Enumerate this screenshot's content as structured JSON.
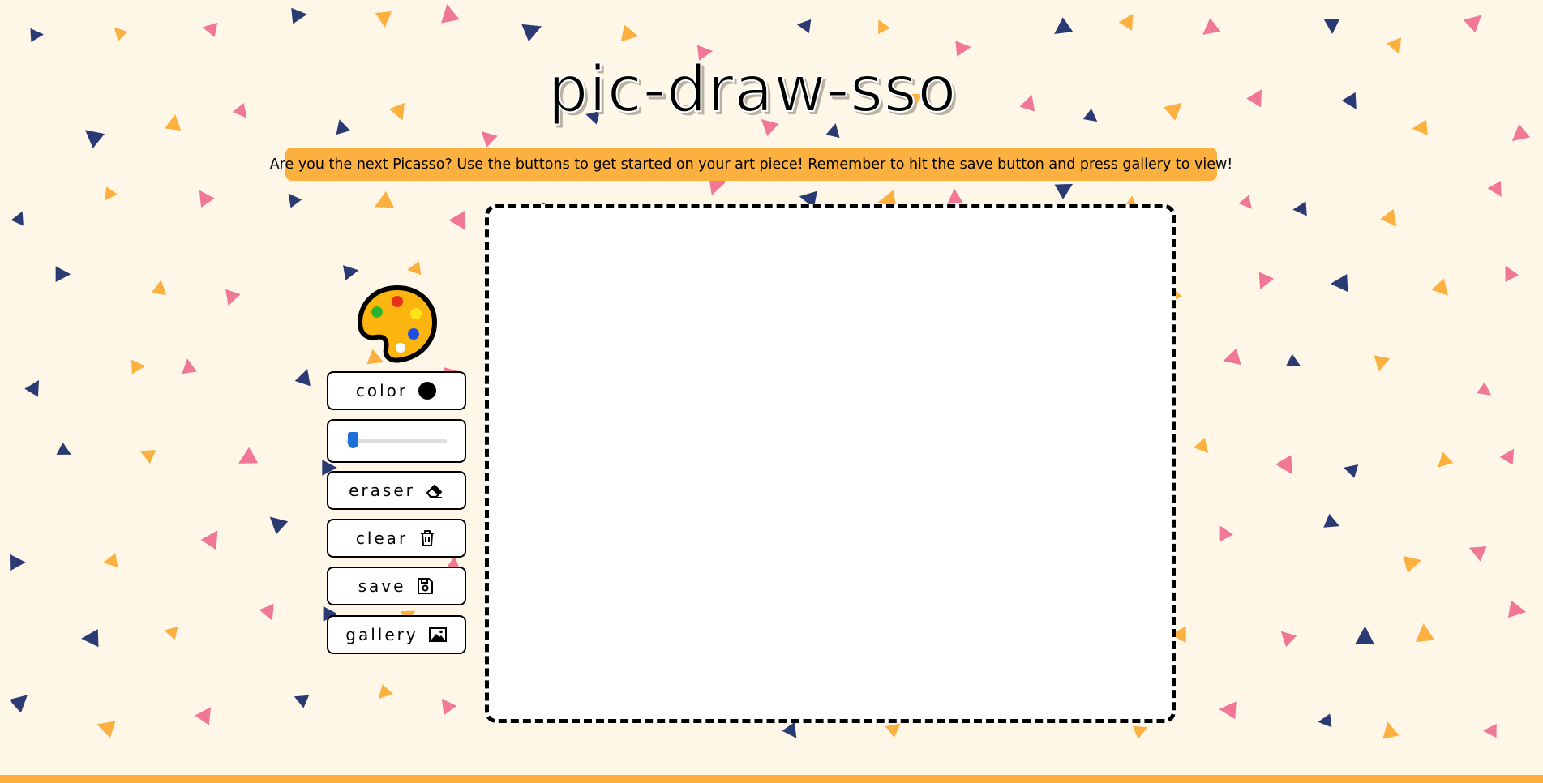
{
  "app": {
    "title": "pic-draw-sso",
    "instructions": "Are you the next Picasso? Use the buttons to get started on your art piece! Remember to hit the save button and press gallery to view!"
  },
  "toolbar": {
    "color_label": "color",
    "current_color": "#000000",
    "brush_size_fraction": 0.02,
    "eraser_label": "eraser",
    "clear_label": "clear",
    "save_label": "save",
    "gallery_label": "gallery"
  },
  "icons": {
    "palette": "artist-palette-icon",
    "color": "filled-circle-icon",
    "eraser": "eraser-icon",
    "clear": "trash-icon",
    "save": "floppy-disk-icon",
    "gallery": "image-icon"
  },
  "colors": {
    "background": "#fef6e6",
    "accent_orange": "#fcb040",
    "confetti_navy": "#2a3a73",
    "confetti_pink": "#f07896",
    "confetti_orange": "#fcb040",
    "slider_thumb": "#1e6fd8"
  }
}
